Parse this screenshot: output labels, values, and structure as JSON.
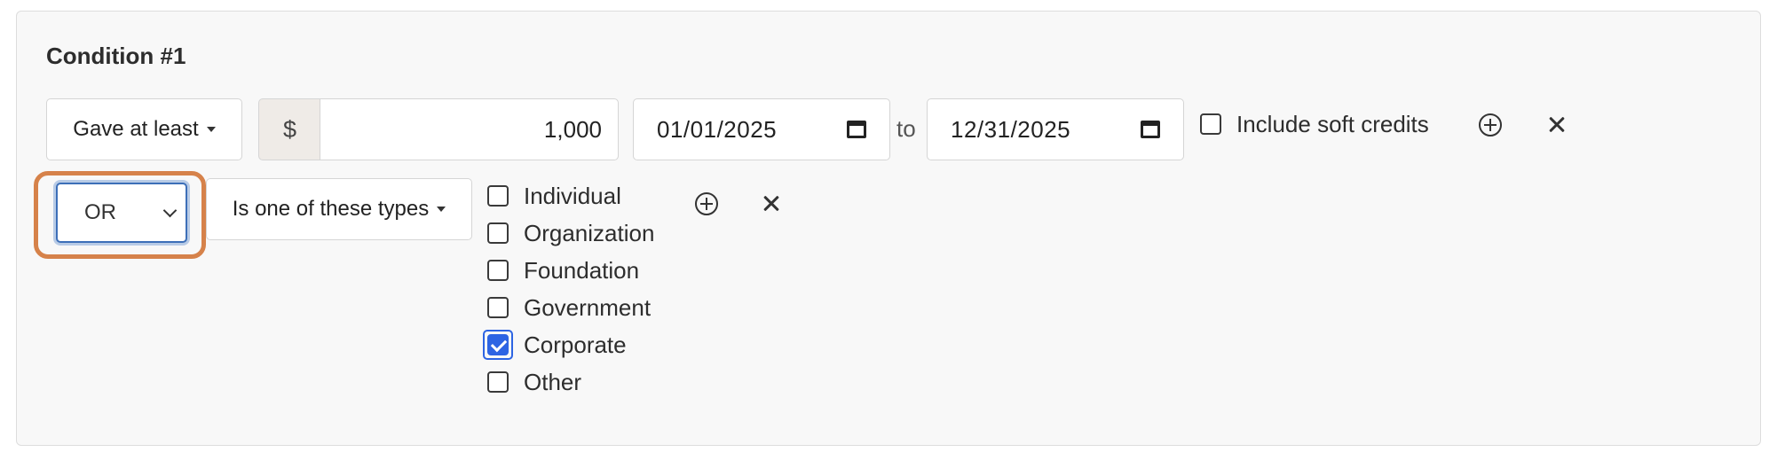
{
  "condition": {
    "title": "Condition #1",
    "row1": {
      "gift_dropdown_label": "Gave at least",
      "currency_symbol": "$",
      "amount_value": "1,000",
      "date_from": "01/01/2025",
      "to_label": "to",
      "date_to": "12/31/2025",
      "soft_credits_label": "Include soft credits",
      "soft_credits_checked": false,
      "add_icon": "plus-circle-icon",
      "remove_icon": "close-icon"
    },
    "row2": {
      "logic_operator": "OR",
      "type_dropdown_label": "Is one of these types",
      "types": [
        {
          "label": "Individual",
          "checked": false
        },
        {
          "label": "Organization",
          "checked": false
        },
        {
          "label": "Foundation",
          "checked": false
        },
        {
          "label": "Government",
          "checked": false
        },
        {
          "label": "Corporate",
          "checked": true
        },
        {
          "label": "Other",
          "checked": false
        }
      ],
      "add_icon": "plus-circle-icon",
      "remove_icon": "close-icon"
    }
  },
  "colors": {
    "highlight": "#d6824a",
    "checkbox_checked": "#2d64e3",
    "panel_background": "#f8f8f8"
  }
}
